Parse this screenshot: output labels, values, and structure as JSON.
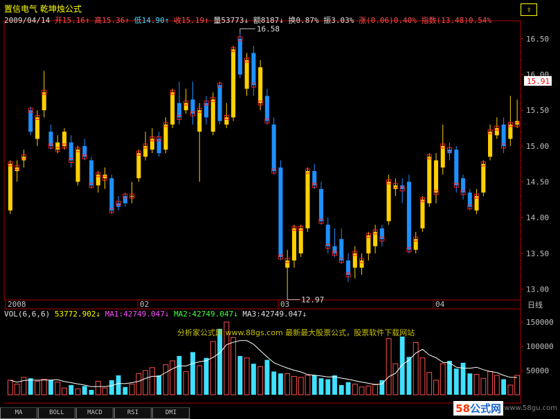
{
  "header": {
    "name": "置信电气",
    "indicator": "乾坤烛公式",
    "date": "2009/04/14",
    "open_label": "开",
    "open": "15.16↑",
    "high_label": "高",
    "high": "15.36↑",
    "low_label": "低",
    "low": "14.90↑",
    "close_label": "收",
    "close": "15.19↑",
    "vol_label": "量",
    "vol": "53773↓",
    "amt_label": "额",
    "amt": "8187↓",
    "turn_label": "换",
    "turn": "0.87%",
    "amp_label": "振",
    "amp": "3.03%",
    "chg_label": "涨",
    "chg": "(0.06)0.40%",
    "idx_label": "指数",
    "idx": "(13.48)0.54%",
    "corner_button": "⇧"
  },
  "price_axis": [
    "16.50",
    "16.00",
    "15.50",
    "15.00",
    "14.50",
    "14.00",
    "13.50",
    "13.00"
  ],
  "current_price": "15.91",
  "annotations": {
    "high": "16.58",
    "low": "12.97"
  },
  "date_axis": {
    "start": "2008",
    "m1": "02",
    "m2": "03",
    "m3": "04",
    "unit": "日线"
  },
  "volume": {
    "title": "VOL(6,6,6)",
    "value": "53772.902↓",
    "ma1": "MA1:42749.047↓",
    "ma2": "MA2:42749.047↓",
    "ma3": "MA3:42749.047↓",
    "axis": [
      "150000",
      "100000",
      "50000"
    ],
    "watermark": "分析家公式网 www.88gs.com 最新最大股票公式，股票软件下载网站"
  },
  "tabs": [
    "MA",
    "BOLL",
    "MACD",
    "RSI",
    "DMI"
  ],
  "logo": {
    "num": "58",
    "text": "公式网"
  },
  "site_url": "www.58gu.com",
  "colors": {
    "up": "#ff4040",
    "down": "#40e0ff",
    "bull": "#ffd000",
    "bear": "#1e90ff",
    "axis": "#b00000"
  },
  "chart_data": {
    "type": "candlestick",
    "ylim": [
      12.85,
      16.75
    ],
    "candles": [
      {
        "o": 14.1,
        "h": 14.8,
        "l": 14.05,
        "c": 14.75,
        "col": "bull"
      },
      {
        "o": 14.65,
        "h": 14.8,
        "l": 14.5,
        "c": 14.7,
        "col": "bull"
      },
      {
        "o": 14.8,
        "h": 14.95,
        "l": 14.7,
        "c": 14.85,
        "col": "bull"
      },
      {
        "o": 15.2,
        "h": 15.55,
        "l": 15.15,
        "c": 15.5,
        "col": "bear"
      },
      {
        "o": 15.1,
        "h": 15.5,
        "l": 15.0,
        "c": 15.4,
        "col": "bull"
      },
      {
        "o": 15.5,
        "h": 16.05,
        "l": 15.4,
        "c": 15.75,
        "col": "bull"
      },
      {
        "o": 15.2,
        "h": 15.3,
        "l": 14.95,
        "c": 15.0,
        "col": "bear"
      },
      {
        "o": 15.05,
        "h": 15.15,
        "l": 14.9,
        "c": 14.95,
        "col": "bull"
      },
      {
        "o": 15.2,
        "h": 15.25,
        "l": 14.95,
        "c": 15.0,
        "col": "bull"
      },
      {
        "o": 15.05,
        "h": 15.15,
        "l": 14.7,
        "c": 14.8,
        "col": "bear"
      },
      {
        "o": 14.5,
        "h": 15.0,
        "l": 14.45,
        "c": 14.95,
        "col": "bull"
      },
      {
        "o": 15.0,
        "h": 15.1,
        "l": 14.8,
        "c": 14.85,
        "col": "bear"
      },
      {
        "o": 14.8,
        "h": 14.85,
        "l": 14.4,
        "c": 14.45,
        "col": "bear"
      },
      {
        "o": 14.45,
        "h": 14.65,
        "l": 14.35,
        "c": 14.6,
        "col": "bull"
      },
      {
        "o": 14.6,
        "h": 14.7,
        "l": 14.4,
        "c": 14.55,
        "col": "bull"
      },
      {
        "o": 14.55,
        "h": 14.6,
        "l": 14.05,
        "c": 14.1,
        "col": "bear"
      },
      {
        "o": 14.15,
        "h": 14.3,
        "l": 14.1,
        "c": 14.2,
        "col": "bear"
      },
      {
        "o": 14.2,
        "h": 14.35,
        "l": 14.15,
        "c": 14.3,
        "col": "bear"
      },
      {
        "o": 14.3,
        "h": 14.5,
        "l": 14.2,
        "c": 14.3,
        "col": "bull"
      },
      {
        "o": 14.55,
        "h": 14.95,
        "l": 14.5,
        "c": 14.9,
        "col": "bull"
      },
      {
        "o": 14.85,
        "h": 15.2,
        "l": 14.8,
        "c": 15.0,
        "col": "bull"
      },
      {
        "o": 14.95,
        "h": 15.25,
        "l": 14.9,
        "c": 15.1,
        "col": "bull"
      },
      {
        "o": 14.9,
        "h": 15.2,
        "l": 14.85,
        "c": 15.1,
        "col": "bear"
      },
      {
        "o": 14.95,
        "h": 15.4,
        "l": 14.9,
        "c": 15.3,
        "col": "bull"
      },
      {
        "o": 15.3,
        "h": 15.8,
        "l": 15.25,
        "c": 15.75,
        "col": "bull"
      },
      {
        "o": 15.6,
        "h": 15.9,
        "l": 15.3,
        "c": 15.4,
        "col": "bear"
      },
      {
        "o": 15.5,
        "h": 15.8,
        "l": 15.45,
        "c": 15.6,
        "col": "bull"
      },
      {
        "o": 15.65,
        "h": 15.9,
        "l": 15.3,
        "c": 15.45,
        "col": "bear"
      },
      {
        "o": 15.2,
        "h": 15.6,
        "l": 14.5,
        "c": 15.5,
        "col": "bull"
      },
      {
        "o": 15.4,
        "h": 15.7,
        "l": 15.3,
        "c": 15.6,
        "col": "bear"
      },
      {
        "o": 15.2,
        "h": 15.75,
        "l": 15.15,
        "c": 15.65,
        "col": "bull"
      },
      {
        "o": 15.35,
        "h": 15.9,
        "l": 15.3,
        "c": 15.85,
        "col": "bear"
      },
      {
        "o": 15.3,
        "h": 15.6,
        "l": 15.25,
        "c": 15.4,
        "col": "bull"
      },
      {
        "o": 15.4,
        "h": 16.4,
        "l": 15.35,
        "c": 16.35,
        "col": "bull"
      },
      {
        "o": 16.0,
        "h": 16.58,
        "l": 15.95,
        "c": 16.5,
        "col": "bear"
      },
      {
        "o": 15.8,
        "h": 16.3,
        "l": 15.7,
        "c": 16.2,
        "col": "bull"
      },
      {
        "o": 16.3,
        "h": 16.4,
        "l": 15.7,
        "c": 15.85,
        "col": "bear"
      },
      {
        "o": 16.1,
        "h": 16.2,
        "l": 15.5,
        "c": 15.6,
        "col": "bull"
      },
      {
        "o": 15.7,
        "h": 15.8,
        "l": 15.3,
        "c": 15.35,
        "col": "bear"
      },
      {
        "o": 15.3,
        "h": 15.4,
        "l": 14.6,
        "c": 14.65,
        "col": "bear"
      },
      {
        "o": 14.7,
        "h": 14.8,
        "l": 13.4,
        "c": 13.45,
        "col": "bear"
      },
      {
        "o": 13.3,
        "h": 13.55,
        "l": 12.97,
        "c": 13.4,
        "col": "bull"
      },
      {
        "o": 13.4,
        "h": 13.9,
        "l": 13.3,
        "c": 13.85,
        "col": "bull"
      },
      {
        "o": 13.5,
        "h": 13.9,
        "l": 13.45,
        "c": 13.85,
        "col": "bull"
      },
      {
        "o": 13.85,
        "h": 14.7,
        "l": 13.8,
        "c": 14.65,
        "col": "bull"
      },
      {
        "o": 14.65,
        "h": 14.75,
        "l": 14.4,
        "c": 14.45,
        "col": "bear"
      },
      {
        "o": 14.4,
        "h": 14.5,
        "l": 13.9,
        "c": 13.95,
        "col": "bear"
      },
      {
        "o": 13.9,
        "h": 14.0,
        "l": 13.5,
        "c": 13.6,
        "col": "bear"
      },
      {
        "o": 13.6,
        "h": 13.85,
        "l": 13.45,
        "c": 13.5,
        "col": "bear"
      },
      {
        "o": 13.7,
        "h": 13.85,
        "l": 13.35,
        "c": 13.4,
        "col": "bear"
      },
      {
        "o": 13.4,
        "h": 13.5,
        "l": 13.1,
        "c": 13.2,
        "col": "bear"
      },
      {
        "o": 13.3,
        "h": 13.6,
        "l": 13.15,
        "c": 13.5,
        "col": "bull"
      },
      {
        "o": 13.3,
        "h": 13.5,
        "l": 13.2,
        "c": 13.4,
        "col": "bull"
      },
      {
        "o": 13.5,
        "h": 13.8,
        "l": 13.4,
        "c": 13.75,
        "col": "bull"
      },
      {
        "o": 13.6,
        "h": 13.9,
        "l": 13.5,
        "c": 13.8,
        "col": "bull"
      },
      {
        "o": 13.85,
        "h": 13.9,
        "l": 13.6,
        "c": 13.7,
        "col": "bear"
      },
      {
        "o": 13.95,
        "h": 14.6,
        "l": 13.9,
        "c": 14.5,
        "col": "bull"
      },
      {
        "o": 14.4,
        "h": 14.55,
        "l": 14.3,
        "c": 14.45,
        "col": "bull"
      },
      {
        "o": 14.45,
        "h": 14.55,
        "l": 14.2,
        "c": 14.4,
        "col": "bear"
      },
      {
        "o": 14.5,
        "h": 14.6,
        "l": 13.5,
        "c": 13.55,
        "col": "bear"
      },
      {
        "o": 13.55,
        "h": 13.8,
        "l": 13.5,
        "c": 13.7,
        "col": "bull"
      },
      {
        "o": 13.85,
        "h": 14.3,
        "l": 13.8,
        "c": 14.25,
        "col": "bull"
      },
      {
        "o": 14.2,
        "h": 14.9,
        "l": 14.15,
        "c": 14.85,
        "col": "bull"
      },
      {
        "o": 14.8,
        "h": 14.9,
        "l": 14.2,
        "c": 14.35,
        "col": "bull"
      },
      {
        "o": 14.7,
        "h": 15.3,
        "l": 14.6,
        "c": 15.0,
        "col": "bull"
      },
      {
        "o": 14.9,
        "h": 15.05,
        "l": 14.8,
        "c": 14.95,
        "col": "bear"
      },
      {
        "o": 14.95,
        "h": 15.0,
        "l": 14.35,
        "c": 14.45,
        "col": "bear"
      },
      {
        "o": 14.55,
        "h": 14.6,
        "l": 14.25,
        "c": 14.35,
        "col": "bear"
      },
      {
        "o": 14.35,
        "h": 14.4,
        "l": 14.1,
        "c": 14.15,
        "col": "bear"
      },
      {
        "o": 14.1,
        "h": 14.4,
        "l": 14.05,
        "c": 14.3,
        "col": "bull"
      },
      {
        "o": 14.35,
        "h": 14.8,
        "l": 14.3,
        "c": 14.75,
        "col": "bull"
      },
      {
        "o": 14.85,
        "h": 15.3,
        "l": 14.8,
        "c": 15.2,
        "col": "bull"
      },
      {
        "o": 15.15,
        "h": 15.4,
        "l": 15.1,
        "c": 15.25,
        "col": "bull"
      },
      {
        "o": 15.3,
        "h": 15.4,
        "l": 14.9,
        "c": 15.0,
        "col": "bear"
      },
      {
        "o": 15.1,
        "h": 15.7,
        "l": 15.0,
        "c": 15.3,
        "col": "bull"
      },
      {
        "o": 15.35,
        "h": 15.65,
        "l": 15.25,
        "c": 15.3,
        "col": "bull"
      }
    ],
    "volumes": [
      30000,
      22000,
      36000,
      34000,
      28000,
      32000,
      30000,
      26000,
      14000,
      20000,
      12000,
      18000,
      10000,
      28000,
      14000,
      30000,
      40000,
      16000,
      22000,
      44000,
      50000,
      56000,
      40000,
      62000,
      70000,
      80000,
      48000,
      88000,
      60000,
      76000,
      110000,
      136000,
      150000,
      118000,
      80000,
      76000,
      64000,
      58000,
      72000,
      48000,
      44000,
      44000,
      38000,
      36000,
      40000,
      40000,
      34000,
      32000,
      40000,
      20000,
      26000,
      22000,
      16000,
      18000,
      22000,
      30000,
      116000,
      64000,
      120000,
      78000,
      108000,
      76000,
      46000,
      30000,
      64000,
      70000,
      54000,
      66000,
      44000,
      42000,
      34000,
      48000,
      40000,
      32000,
      20000,
      40000,
      78000,
      54000,
      48000,
      70000,
      56000
    ]
  }
}
